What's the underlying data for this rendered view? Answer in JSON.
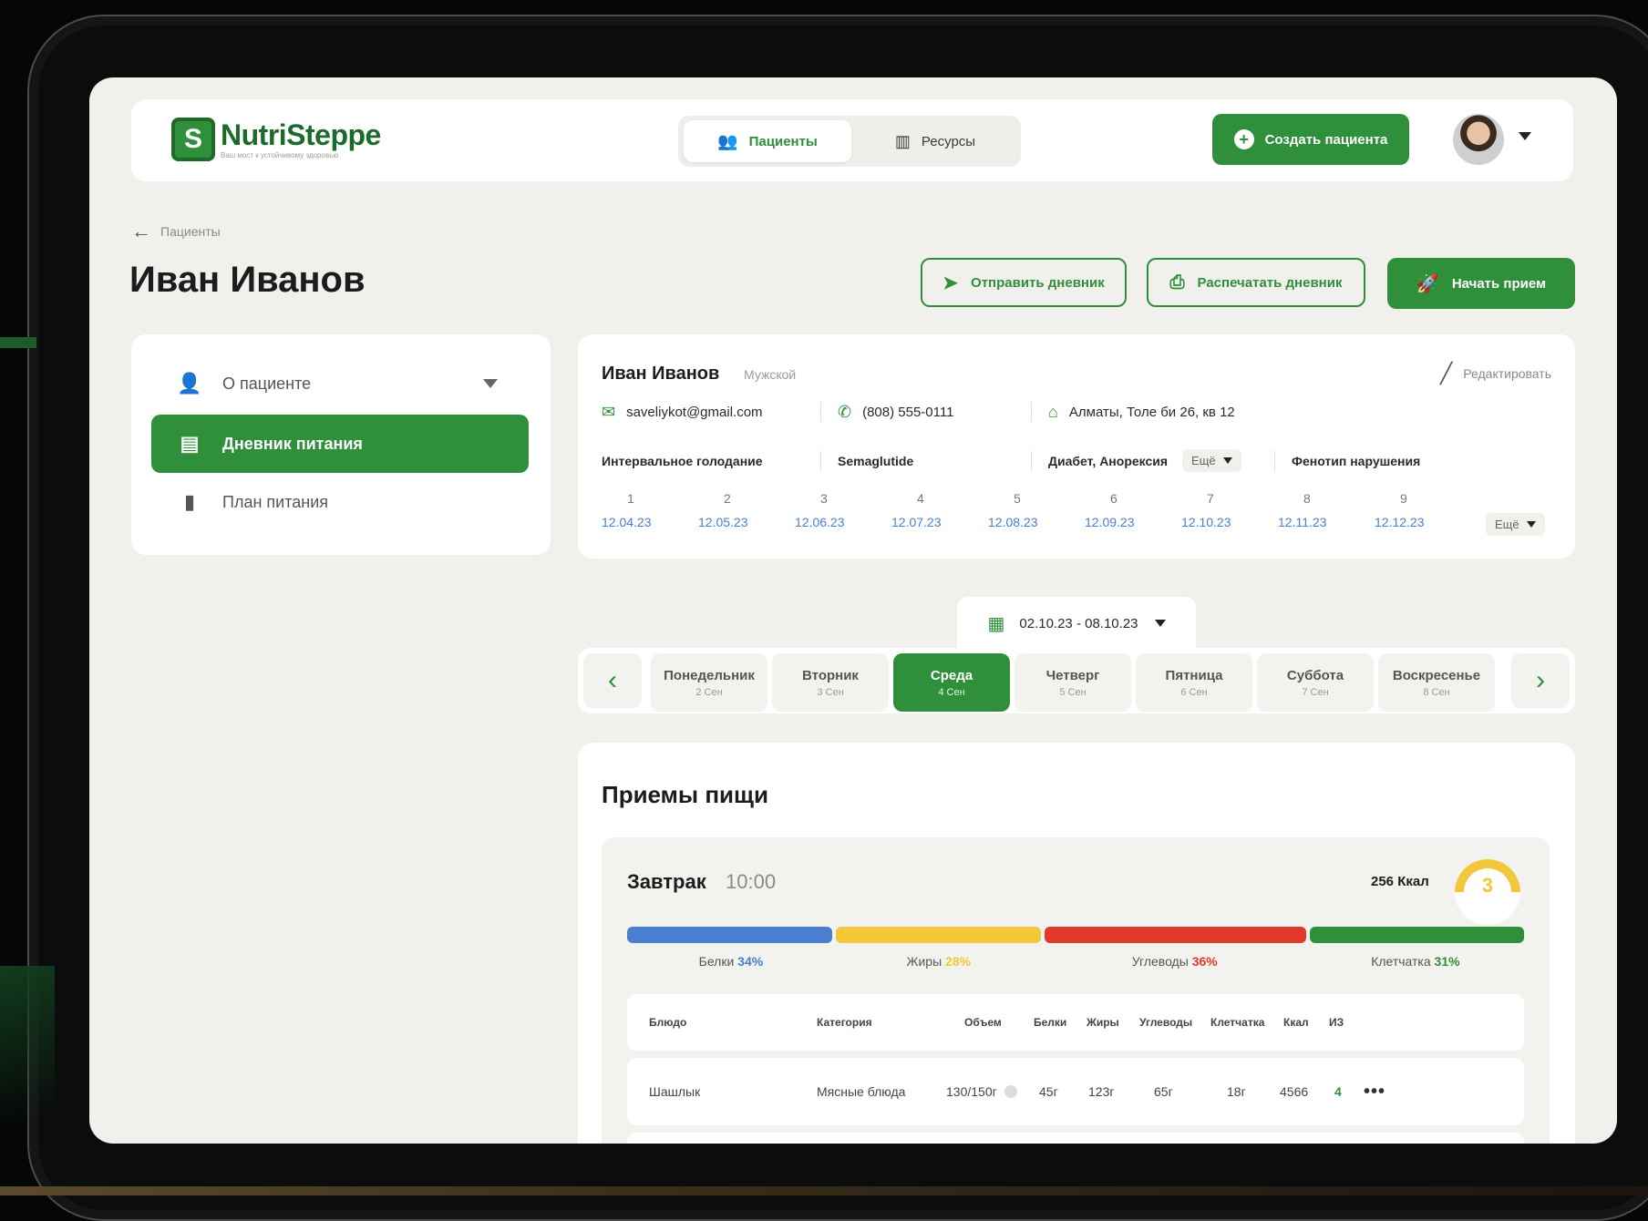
{
  "brand": {
    "name": "NutriSteppe",
    "tagline": "Ваш мост к устойчивому здоровью"
  },
  "nav": {
    "tabs": [
      {
        "label": "Пациенты",
        "active": true
      },
      {
        "label": "Ресурсы",
        "active": false
      }
    ]
  },
  "header": {
    "create_label": "Создать пациента"
  },
  "breadcrumb": {
    "back_label": "Пациенты"
  },
  "page": {
    "title": "Иван Иванов"
  },
  "actions": {
    "send": "Отправить дневник",
    "print": "Распечатать дневник",
    "start": "Начать прием"
  },
  "sidebar": {
    "items": [
      {
        "label": "О пациенте",
        "icon": "user-icon"
      },
      {
        "label": "Дневник питания",
        "icon": "journal-icon",
        "active": true
      },
      {
        "label": "План питания",
        "icon": "clipboard-icon"
      }
    ]
  },
  "patient": {
    "name": "Иван Иванов",
    "gender": "Мужской",
    "edit_label": "Редактировать",
    "email": "saveliykot@gmail.com",
    "phone": "(808) 555-0111",
    "address": "Алматы, Толе би 26, кв 12",
    "diet": "Интервальное голодание",
    "medication": "Semaglutide",
    "conditions": "Диабет, Анорексия",
    "more_label": "Ещё",
    "phenotype": "Фенотип нарушения",
    "visits": [
      {
        "num": "1",
        "date": "12.04.23"
      },
      {
        "num": "2",
        "date": "12.05.23"
      },
      {
        "num": "3",
        "date": "12.06.23"
      },
      {
        "num": "4",
        "date": "12.07.23"
      },
      {
        "num": "5",
        "date": "12.08.23"
      },
      {
        "num": "6",
        "date": "12.09.23"
      },
      {
        "num": "7",
        "date": "12.10.23"
      },
      {
        "num": "8",
        "date": "12.11.23"
      },
      {
        "num": "9",
        "date": "12.12.23"
      }
    ]
  },
  "week": {
    "range": "02.10.23 - 08.10.23",
    "days": [
      {
        "name": "Понедельник",
        "date": "2 Сен"
      },
      {
        "name": "Вторник",
        "date": "3 Сен"
      },
      {
        "name": "Среда",
        "date": "4 Сен",
        "active": true
      },
      {
        "name": "Четверг",
        "date": "5 Сен"
      },
      {
        "name": "Пятница",
        "date": "6 Сен"
      },
      {
        "name": "Суббота",
        "date": "7 Сен"
      },
      {
        "name": "Воскресенье",
        "date": "8 Сен"
      }
    ]
  },
  "meals": {
    "title": "Приемы пищи",
    "items": [
      {
        "name": "Завтрак",
        "time": "10:00",
        "kcal": "256 Ккал",
        "score": "3",
        "macros": [
          {
            "label": "Белки",
            "value": "34%",
            "color": "#4a7fd0",
            "share": 0.22
          },
          {
            "label": "Жиры",
            "value": "28%",
            "color": "#f2c73a",
            "share": 0.22
          },
          {
            "label": "Углеводы",
            "value": "36%",
            "color": "#e23a2a",
            "share": 0.28
          },
          {
            "label": "Клетчатка",
            "value": "31%",
            "color": "#2f8f3a",
            "share": 0.23
          }
        ],
        "table": {
          "headers": [
            "Блюдо",
            "Категория",
            "Объем",
            "Белки",
            "Жиры",
            "Углеводы",
            "Клетчатка",
            "Ккал",
            "ИЗ"
          ],
          "rows": [
            {
              "dish": "Шашлык",
              "category": "Мясные блюда",
              "volume": "130/150г",
              "protein": "45г",
              "fat": "123г",
              "carbs": "65г",
              "fiber": "18г",
              "kcal": "4566",
              "gi": "4"
            }
          ]
        }
      }
    ]
  },
  "colors": {
    "accent": "#2f8f3a",
    "link": "#4a7fd0",
    "background": "#f1f0ec"
  }
}
